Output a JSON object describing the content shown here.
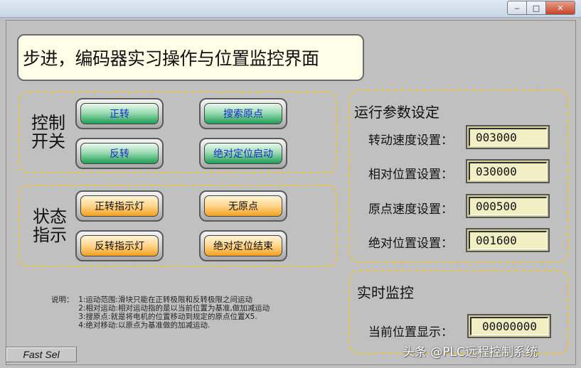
{
  "window": {
    "controls": {
      "minimize": "‒",
      "maximize": "□",
      "close": "✕"
    }
  },
  "title": "步进，编码器实习操作与位置监控界面",
  "control_group": {
    "label_line1": "控制",
    "label_line2": "开关",
    "buttons": [
      "正转",
      "搜索原点",
      "反转",
      "绝对定位启动"
    ]
  },
  "status_group": {
    "label_line1": "状态",
    "label_line2": "指示",
    "indicators": [
      "正转指示灯",
      "无原点",
      "反转指示灯",
      "绝对定位结束"
    ]
  },
  "params": {
    "title": "运行参数设定",
    "items": [
      {
        "label": "转动速度设置：",
        "value": "003000"
      },
      {
        "label": "相对位置设置：",
        "value": "030000"
      },
      {
        "label": "原点速度设置：",
        "value": "000500"
      },
      {
        "label": "绝对位置设置：",
        "value": "001600"
      }
    ]
  },
  "monitor": {
    "title": "实时监控",
    "label": "当前位置显示：",
    "value": "00000000"
  },
  "notes": {
    "prefix": "说明：",
    "lines": [
      "1:运动范围:滑块只能在正转极限和反转极限之间运动",
      "2:相对运动:相对运动指的是以当前位置为基准,做加减运动",
      "3:搜原点:就是将电机的位置移动到规定的原点位置X5.",
      "4:绝对移动:以原点为基准做的加减运动."
    ]
  },
  "fast_sel": "Fast Sel",
  "watermark": "头条 @PLC远程控制系统"
}
